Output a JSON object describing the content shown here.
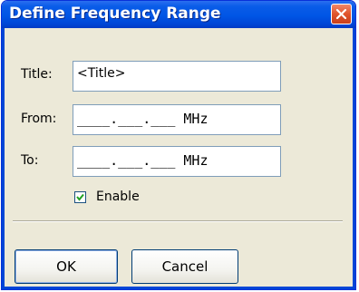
{
  "window": {
    "title": "Define Frequency Range"
  },
  "fields": {
    "title_label": "Title:",
    "title_value": "<Title>",
    "from_label": "From:",
    "from_mask": "____.___.___ MHz",
    "to_label": "To:",
    "to_mask": "____.___.___ MHz"
  },
  "enable": {
    "label": "Enable",
    "checked": true
  },
  "buttons": {
    "ok_label": "OK",
    "cancel_label": "Cancel"
  },
  "colors": {
    "titlebar": "#0055e5",
    "dialog_bg": "#ece9d8",
    "close_button": "#e0542c"
  }
}
